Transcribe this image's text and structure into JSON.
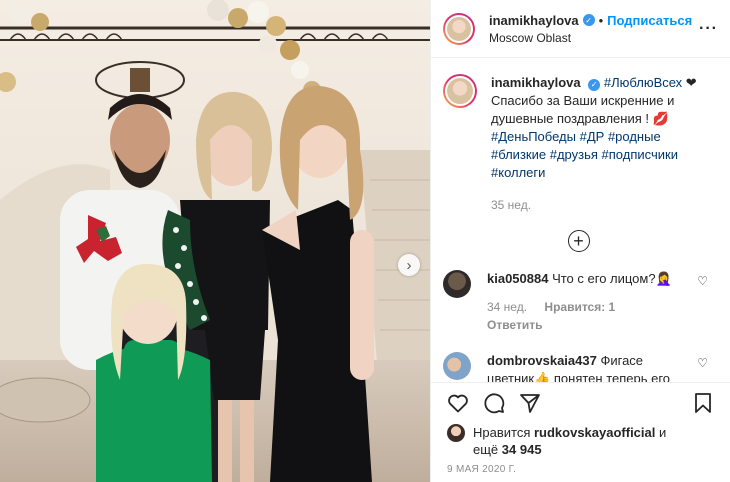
{
  "post": {
    "username": "inamikhaylova",
    "follow_label": "Подписаться",
    "dot": "•",
    "location": "Moscow Oblast",
    "more_label": "···"
  },
  "caption": {
    "username": "inamikhaylova",
    "text_1": "#ЛюблюВсех",
    "text_2": " ❤ Спасибо за Ваши искренние и душевные поздравления ! 💋",
    "hashtags": [
      "#ДеньПобеды",
      "#ДР",
      "#родные",
      "#близкие",
      "#друзья",
      "#подписчики",
      "#коллеги"
    ],
    "age": "35 нед."
  },
  "load_more": "+",
  "comments": [
    {
      "username": "kia050884",
      "text": "Что с его лицом?🤦‍♀️",
      "age": "34 нед.",
      "likes": "Нравится: 1",
      "reply": "Ответить"
    },
    {
      "username": "dombrovskaia437",
      "text": "Фигасе цветник👍 понятен теперь его посыл в песнях всей женской половине человечества👆",
      "age": "",
      "likes": "",
      "reply": ""
    }
  ],
  "likes_line": {
    "prefix": "Нравится ",
    "user": "rudkovskayaofficial",
    "mid": " и",
    "line2_prefix": "ещё ",
    "count": "34 945"
  },
  "date": "9 МАЯ 2020 Г.",
  "icons": {
    "verified": "✓",
    "next": "›",
    "heart": "♡"
  },
  "colors": {
    "link_blue": "#0095f6",
    "hashtag": "#00376b",
    "muted": "#8e8e8e",
    "verified": "#3897f0"
  }
}
